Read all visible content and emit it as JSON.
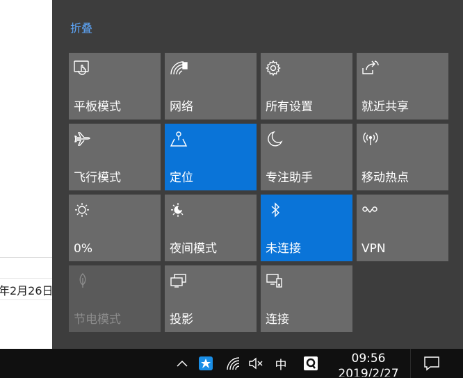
{
  "background_app": {
    "date_text": "年2月26日"
  },
  "action_center": {
    "collapse_label": "折叠",
    "tiles": [
      {
        "label": "平板模式",
        "icon": "tablet-mode-icon",
        "state": "off"
      },
      {
        "label": "网络",
        "icon": "network-icon",
        "state": "off"
      },
      {
        "label": "所有设置",
        "icon": "gear-icon",
        "state": "off"
      },
      {
        "label": "就近共享",
        "icon": "nearby-share-icon",
        "state": "off"
      },
      {
        "label": "飞行模式",
        "icon": "airplane-icon",
        "state": "off"
      },
      {
        "label": "定位",
        "icon": "location-icon",
        "state": "on"
      },
      {
        "label": "专注助手",
        "icon": "moon-icon",
        "state": "off"
      },
      {
        "label": "移动热点",
        "icon": "hotspot-icon",
        "state": "off"
      },
      {
        "label": "0%",
        "icon": "brightness-icon",
        "state": "off"
      },
      {
        "label": "夜间模式",
        "icon": "night-light-icon",
        "state": "off"
      },
      {
        "label": "未连接",
        "icon": "bluetooth-icon",
        "state": "on"
      },
      {
        "label": "VPN",
        "icon": "vpn-icon",
        "state": "off"
      },
      {
        "label": "节电模式",
        "icon": "battery-saver-icon",
        "state": "disabled"
      },
      {
        "label": "投影",
        "icon": "project-icon",
        "state": "off"
      },
      {
        "label": "连接",
        "icon": "connect-icon",
        "state": "off"
      }
    ],
    "colors": {
      "panel": "#3d3d3d",
      "tile": "#6a6a6a",
      "tile_active": "#0a74d8",
      "accent_link": "#5ea9ff"
    }
  },
  "taskbar": {
    "ime_label": "中",
    "time": "09:56",
    "date": "2019/2/27",
    "tray_icons": [
      "chevron-up-icon",
      "app-tray-icon",
      "wifi-icon",
      "volume-muted-icon",
      "ime-icon",
      "qq-icon",
      "notification-icon"
    ]
  }
}
